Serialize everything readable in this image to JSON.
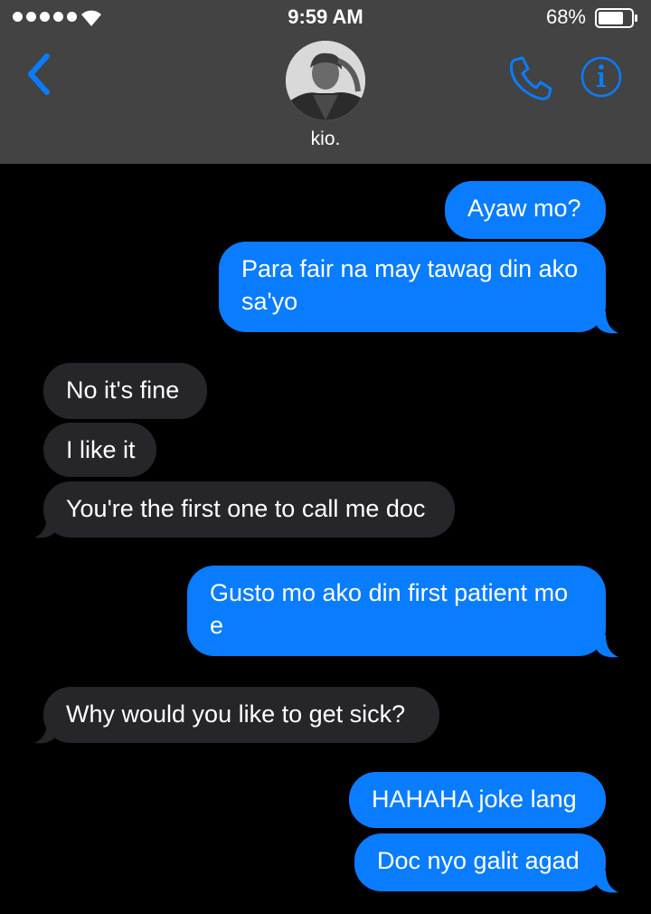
{
  "status_bar": {
    "time": "9:59 AM",
    "battery_percent": "68%",
    "battery_level": 0.68,
    "signal_bars": 5
  },
  "header": {
    "contact_name": "kio.",
    "icons": {
      "back": "chevron-left-icon",
      "phone": "phone-icon",
      "info": "info-icon"
    }
  },
  "colors": {
    "accent": "#0a7cff",
    "sent_bubble": "#0a7cff",
    "received_bubble": "#262529",
    "header_bg": "#434343",
    "background": "#000000"
  },
  "messages": [
    {
      "direction": "sent",
      "text": "Ayaw mo?"
    },
    {
      "direction": "sent",
      "text": "Para fair na may tawag din ako sa'yo"
    },
    {
      "direction": "received",
      "text": "No it's fine"
    },
    {
      "direction": "received",
      "text": "I like it"
    },
    {
      "direction": "received",
      "text": "You're the first one to call me doc"
    },
    {
      "direction": "sent",
      "text": "Gusto mo ako din first patient mo e"
    },
    {
      "direction": "received",
      "text": "Why would you like to get sick?"
    },
    {
      "direction": "sent",
      "text": "HAHAHA joke lang"
    },
    {
      "direction": "sent",
      "text": "Doc nyo galit agad"
    }
  ]
}
